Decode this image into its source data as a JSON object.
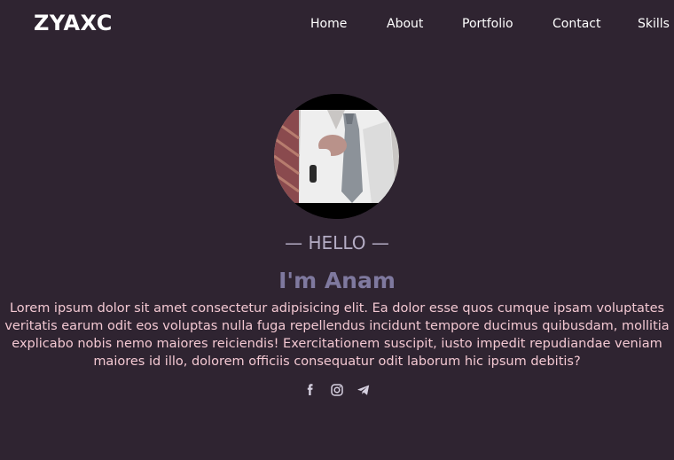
{
  "navbar": {
    "logo": "ZYAXC",
    "links": [
      {
        "label": "Home"
      },
      {
        "label": "About"
      },
      {
        "label": "Portfolio"
      },
      {
        "label": "Contact"
      },
      {
        "label": "Skills"
      }
    ]
  },
  "hero": {
    "greeting": "— HELLO —",
    "name": "I'm Anam",
    "bio": "Lorem ipsum dolor sit amet consectetur adipisicing elit. Ea dolor esse quos cumque ipsam voluptates veritatis earum odit eos voluptas nulla fuga repellendus incidunt tempore ducimus quibusdam, mollitia explicabo nobis nemo maiores reiciendis! Exercitationem suscipit, iusto impedit repudiandae veniam maiores id illo, dolorem officiis consequatur odit laborum hic ipsum debitis?",
    "socials": [
      {
        "icon": "facebook-icon"
      },
      {
        "icon": "instagram-icon"
      },
      {
        "icon": "telegram-icon"
      }
    ]
  },
  "colors": {
    "background": "#2f2431",
    "greeting": "#b4acc4",
    "name": "#7f799f",
    "bio": "#f3c8d2"
  }
}
